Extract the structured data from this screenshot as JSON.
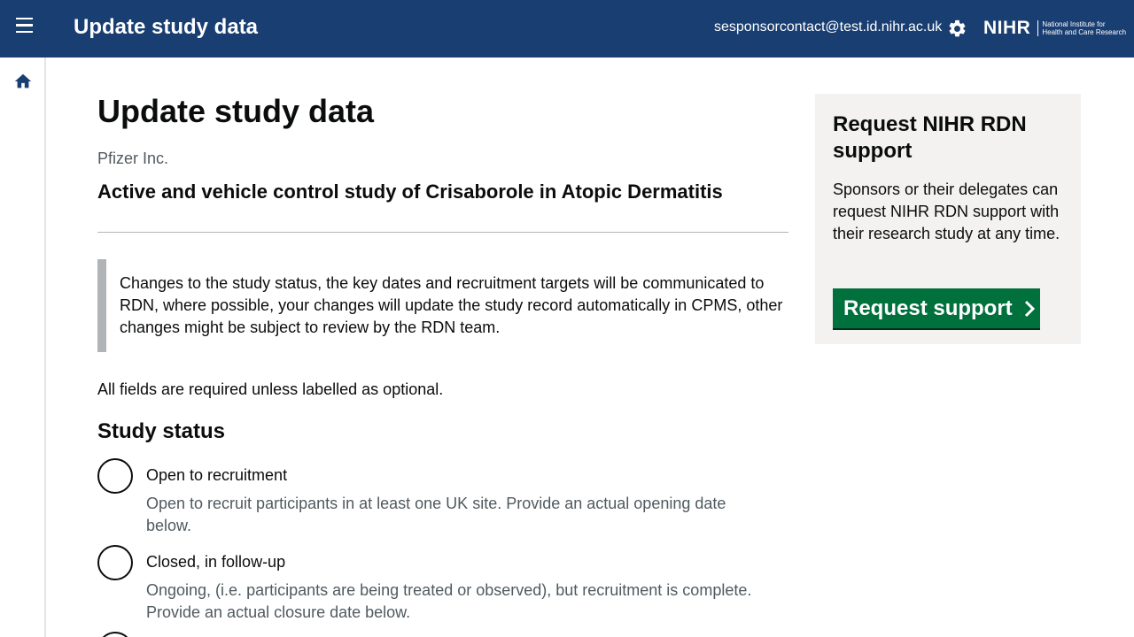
{
  "header": {
    "title": "Update study data",
    "user_email": "sesponsorcontact@test.id.nihr.ac.uk",
    "logo": {
      "mark": "NIHR",
      "tagline_line1": "National Institute for",
      "tagline_line2": "Health and Care Research"
    },
    "icons": [
      "menu-icon",
      "gear-icon"
    ]
  },
  "sidebar": {
    "icons": [
      "home-icon"
    ]
  },
  "main": {
    "page_title": "Update study data",
    "organisation": "Pfizer Inc.",
    "study_title": "Active and vehicle control study of Crisaborole in Atopic Dermatitis",
    "inset_text": "Changes to the study status, the key dates and recruitment targets will be communicated to RDN, where possible, your changes will update the study record automatically in CPMS, other changes might be subject to review by the RDN team.",
    "fields_note": "All fields are required unless labelled as optional.",
    "study_status": {
      "heading": "Study status",
      "options": [
        {
          "label": "Open to recruitment",
          "hint": "Open to recruit participants in at least one UK site. Provide an actual opening date below.",
          "selected": false
        },
        {
          "label": "Closed, in follow-up",
          "hint": "Ongoing, (i.e. participants are being treated or observed), but recruitment is complete. Provide an actual closure date below.",
          "selected": false
        }
      ]
    }
  },
  "aside": {
    "title": "Request NIHR RDN support",
    "body": "Sponsors or their delegates can request NIHR RDN support with their research study at any time.",
    "button_label": "Request support"
  },
  "colors": {
    "header_bg": "#193e72",
    "button_green": "#00703c",
    "aside_bg": "#f3f2f1",
    "hint_grey": "#505a5f"
  }
}
